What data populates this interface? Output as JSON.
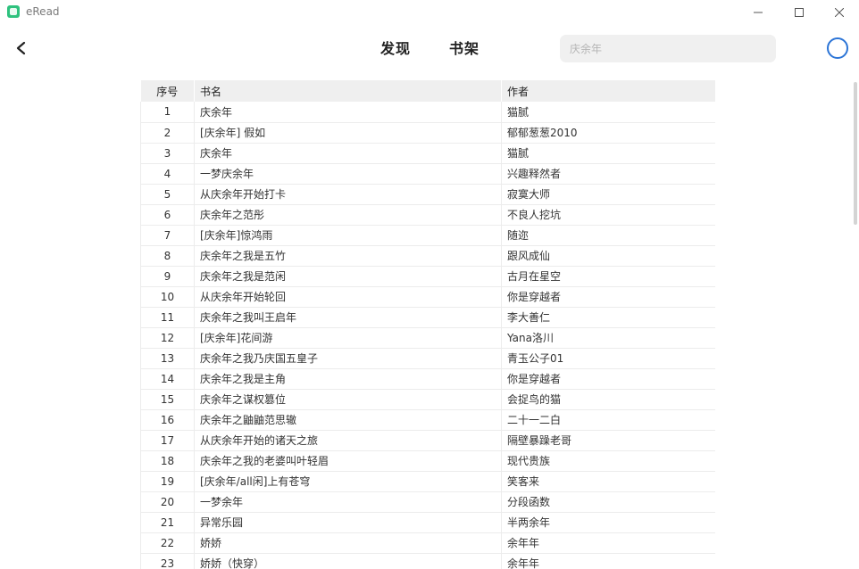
{
  "app": {
    "title": "eRead"
  },
  "nav": {
    "tabs": [
      {
        "label": "发现"
      },
      {
        "label": "书架"
      }
    ],
    "search": {
      "value": "",
      "placeholder": "庆余年"
    }
  },
  "table": {
    "headers": [
      "序号",
      "书名",
      "作者"
    ],
    "rows": [
      [
        "1",
        "庆余年",
        "猫腻"
      ],
      [
        "2",
        "[庆余年] 假如",
        "郁郁葱葱2010"
      ],
      [
        "3",
        "庆余年",
        "猫腻"
      ],
      [
        "4",
        "一梦庆余年",
        "兴趣释然者"
      ],
      [
        "5",
        "从庆余年开始打卡",
        "寂寞大师"
      ],
      [
        "6",
        "庆余年之范彤",
        "不良人挖坑"
      ],
      [
        "7",
        "[庆余年]惊鸿雨",
        "随迩"
      ],
      [
        "8",
        "庆余年之我是五竹",
        "跟风成仙"
      ],
      [
        "9",
        "庆余年之我是范闲",
        "古月在星空"
      ],
      [
        "10",
        "从庆余年开始轮回",
        "你是穿越者"
      ],
      [
        "11",
        "庆余年之我叫王启年",
        "李大善仁"
      ],
      [
        "12",
        "[庆余年]花间游",
        "Yana洛川"
      ],
      [
        "13",
        "庆余年之我乃庆国五皇子",
        "青玉公子01"
      ],
      [
        "14",
        "庆余年之我是主角",
        "你是穿越者"
      ],
      [
        "15",
        "庆余年之谋权篡位",
        "会捉鸟的猫"
      ],
      [
        "16",
        "庆余年之鼬鼬范思辙",
        "二十一二白"
      ],
      [
        "17",
        "从庆余年开始的诸天之旅",
        "隔壁暴躁老哥"
      ],
      [
        "18",
        "庆余年之我的老婆叫叶轻眉",
        "现代贵族"
      ],
      [
        "19",
        "[庆余年/all闲]上有苍穹",
        "笑客来"
      ],
      [
        "20",
        "一梦余年",
        "分段函数"
      ],
      [
        "21",
        "异常乐园",
        "半两余年"
      ],
      [
        "22",
        "娇娇",
        "余年年"
      ],
      [
        "23",
        "娇娇（快穿）",
        "余年年"
      ]
    ]
  }
}
